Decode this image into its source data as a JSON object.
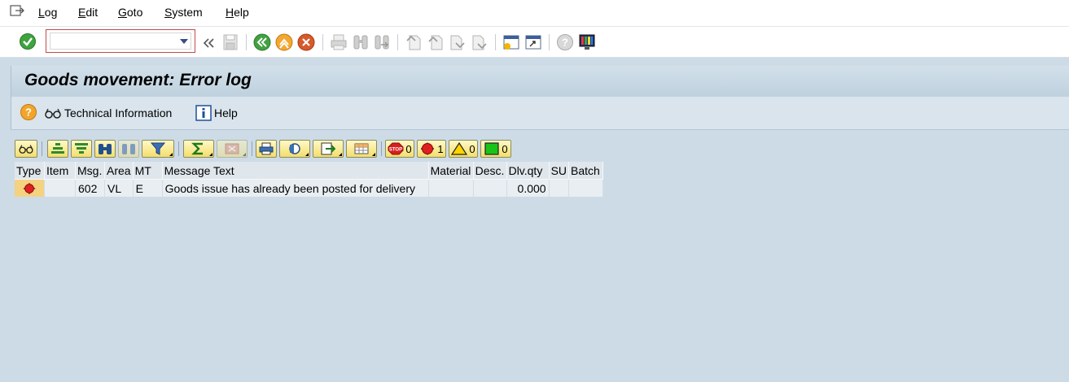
{
  "menu": {
    "items": [
      {
        "first": "L",
        "rest": "og"
      },
      {
        "first": "E",
        "rest": "dit"
      },
      {
        "first": "G",
        "rest": "oto"
      },
      {
        "first": "S",
        "rest": "ystem"
      },
      {
        "first": "H",
        "rest": "elp"
      }
    ]
  },
  "command_field": {
    "value": ""
  },
  "title": "Goods movement: Error log",
  "app_toolbar": {
    "technical_info_label": "Technical Information",
    "help_label": "Help"
  },
  "alv_counts": {
    "stop": "0",
    "error": "1",
    "warning": "0",
    "success": "0"
  },
  "table": {
    "columns": [
      "Type",
      "Item",
      "Msg.",
      "Area",
      "MT",
      "Message Text",
      "Material",
      "Desc.",
      "Dlv.qty",
      "SU",
      "Batch"
    ],
    "rows": [
      {
        "type_icon": "red-error-icon",
        "item": "",
        "msg": "602",
        "area": "VL",
        "mt": "E",
        "text": "Goods issue has already been posted for delivery",
        "material": "",
        "desc": "",
        "dlv_qty": "0.000",
        "su": "",
        "batch": ""
      }
    ]
  },
  "colors": {
    "background": "#cddbe6",
    "title_bar": "#c6d6e2",
    "alv_button": "#f3de6c",
    "error_red": "#e02020"
  }
}
